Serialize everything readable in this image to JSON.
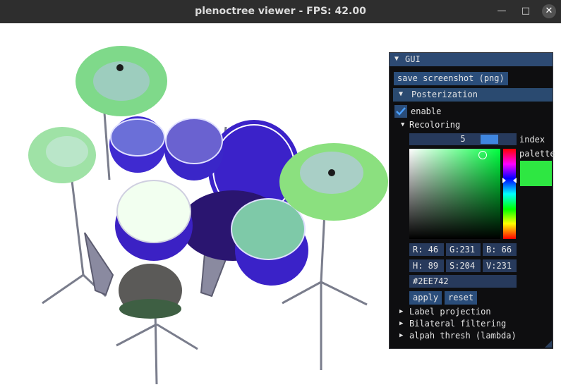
{
  "window": {
    "title": "plenoctree viewer - FPS: 42.00",
    "minimize_glyph": "—",
    "maximize_glyph": "□",
    "close_glyph": "✕"
  },
  "gui": {
    "header_arrow": "▼",
    "header_title": "GUI",
    "save_screenshot_label": "save screenshot (png)",
    "posterization": {
      "arrow": "▼",
      "label": "Posterization",
      "enable_label": "enable",
      "enable_checked": true
    },
    "recoloring": {
      "arrow": "▼",
      "label": "Recoloring",
      "index_value": "5",
      "index_label": "index",
      "palette_label": "palette",
      "color_hex": "#2EE742",
      "rgb": {
        "r": "R: 46",
        "g": "G:231",
        "b": "B: 66"
      },
      "hsv": {
        "h": "H: 89",
        "s": "S:204",
        "v": "V:231"
      },
      "apply_label": "apply",
      "reset_label": "reset"
    },
    "collapsed_sections": [
      {
        "arrow": "▶",
        "label": "Label projection"
      },
      {
        "arrow": "▶",
        "label": "Bilateral filtering"
      },
      {
        "arrow": "▶",
        "label": "alpah thresh (lambda)"
      }
    ]
  }
}
